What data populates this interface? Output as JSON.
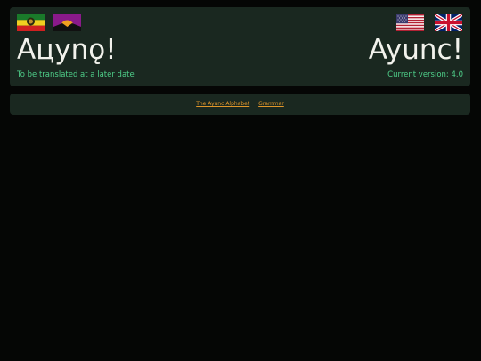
{
  "header": {
    "title_native": "Aцynǫ!",
    "title_english": "Ayunc!",
    "subtitle_left": "To be translated at a later date",
    "version_text": "Current version: 4.0",
    "flags": [
      {
        "name": "ayunc-flag-green",
        "colors": [
          "#1a7a2a",
          "#f0d020",
          "#d02020"
        ]
      },
      {
        "name": "ayunc-flag-purple",
        "colors": [
          "#8a1a8a",
          "#f0a020",
          "#101010"
        ]
      },
      {
        "name": "us-flag",
        "colors": [
          "#b22234",
          "#ffffff",
          "#3c3b6e"
        ]
      },
      {
        "name": "uk-flag",
        "colors": [
          "#012169",
          "#ffffff",
          "#c8102e"
        ]
      }
    ]
  },
  "nav": {
    "links": [
      "The Ayunc Alphabet",
      "Grammar"
    ]
  },
  "colors": {
    "background": "#050605",
    "panel": "#1a2820",
    "title": "#f2f2ec",
    "accent_green": "#4fd08a",
    "link": "#e0962a"
  }
}
